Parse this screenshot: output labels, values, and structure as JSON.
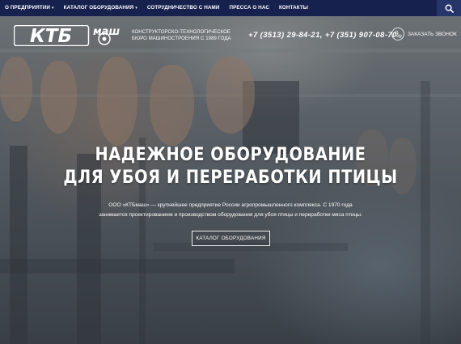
{
  "nav": {
    "items": [
      {
        "label": "О предприятии",
        "caret": true
      },
      {
        "label": "Каталог оборудования",
        "caret": true
      },
      {
        "label": "Сотрудничество с нами",
        "caret": false
      },
      {
        "label": "Пресса о нас",
        "caret": false
      },
      {
        "label": "Контакты",
        "caret": false
      }
    ],
    "search_icon": "search-icon"
  },
  "header": {
    "logo_left": "КТБ",
    "logo_right": "маш",
    "tagline_line1": "Конструкторско-технологическое",
    "tagline_line2": "бюро машиностроения с 1989 года",
    "phones": "+7 (3513) 29-84-21, +7 (351) 907-08-70",
    "callback_label": "Заказать звонок",
    "callback_icon": "phone-icon"
  },
  "hero": {
    "title_line1": "Надежное оборудование",
    "title_line2": "для убоя и переработки птицы",
    "desc_line1": "ООО «КТБмаш» — крупнейшее предприятие России агропромышленного комплекса. С 1970 года",
    "desc_line2": "занимается проектированием и производством оборудования для убоя птицы и переработки мяса птицы.",
    "cta_label": "Каталог оборудования"
  },
  "colors": {
    "nav_bg": "#17214e",
    "search_bg": "#26366b"
  }
}
